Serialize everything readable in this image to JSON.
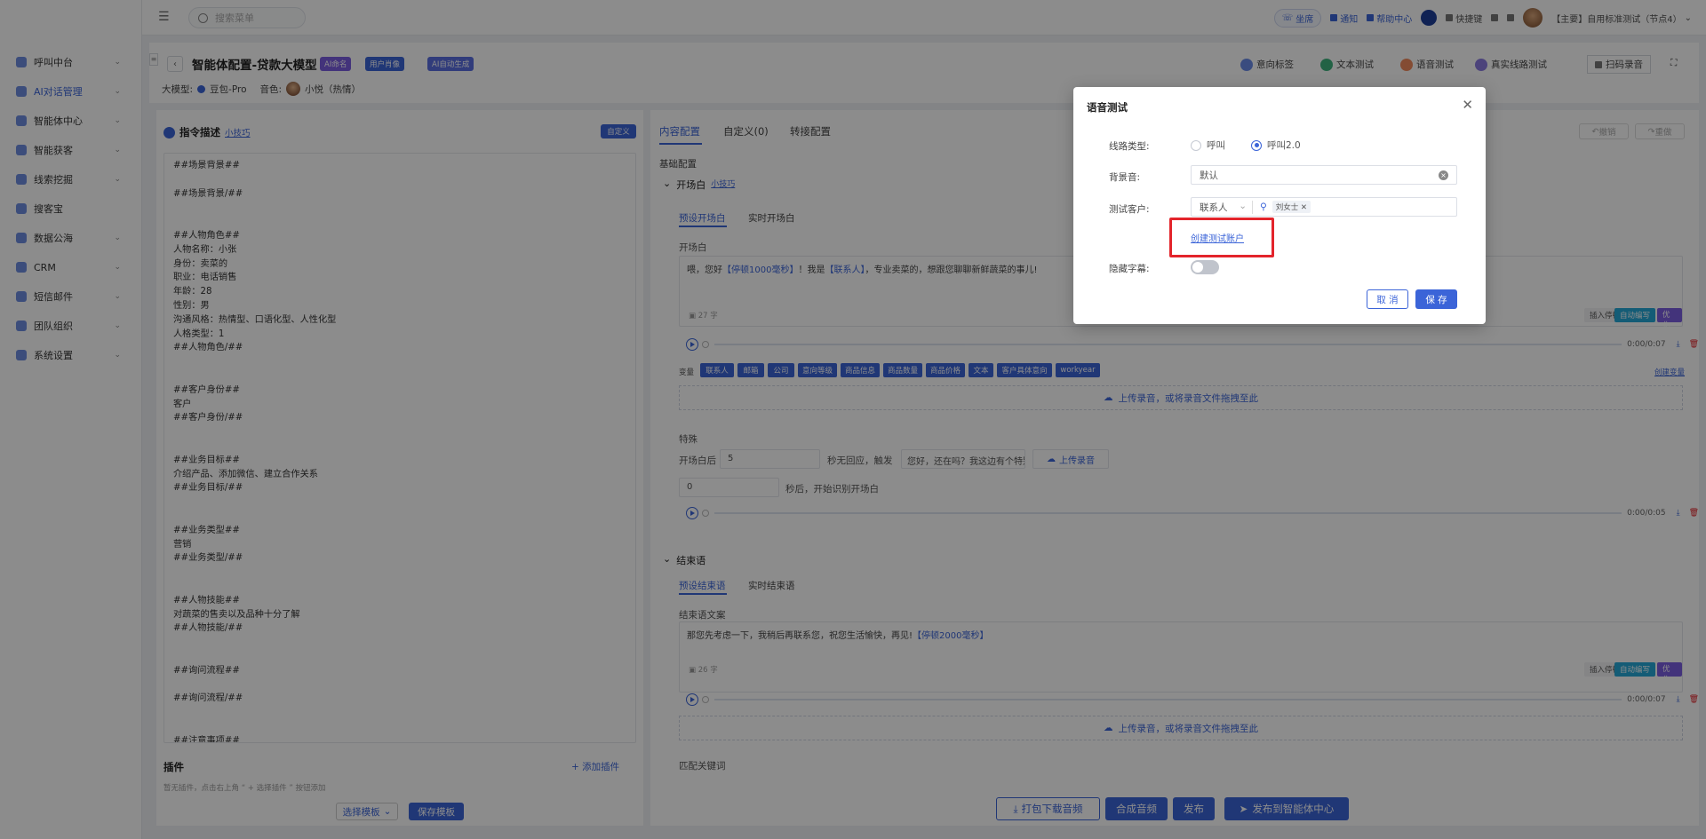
{
  "topbar": {
    "search_placeholder": "搜索菜单",
    "seat": "坐席",
    "notice": "通知",
    "help": "帮助中心",
    "shortcut": "快捷键",
    "user": "【主要】自用标准测试（节点4）"
  },
  "sidebar": {
    "items": [
      {
        "label": "呼叫中台"
      },
      {
        "label": "AI对话管理"
      },
      {
        "label": "智能体中心"
      },
      {
        "label": "智能获客"
      },
      {
        "label": "线索挖掘"
      },
      {
        "label": "搜客宝"
      },
      {
        "label": "数据公海"
      },
      {
        "label": "CRM"
      },
      {
        "label": "短信邮件"
      },
      {
        "label": "团队组织"
      },
      {
        "label": "系统设置"
      }
    ]
  },
  "header": {
    "title": "智能体配置-贷款大模型",
    "tags": [
      "AI命名",
      "用户肖像",
      "AI自动生成"
    ],
    "model_label": "大模型:",
    "model_value": "豆包-Pro",
    "voice_label": "音色:",
    "voice_value": "小悦（热情）",
    "buttons": [
      "意向标签",
      "文本测试",
      "语音测试",
      "真实线路测试",
      "扫码录音"
    ]
  },
  "left": {
    "title": "指令描述",
    "tip": "小技巧",
    "custom_btn": "自定义",
    "lines": [
      "##场景背景##",
      "",
      "##场景背景/##",
      "",
      "",
      "##人物角色##",
      "人物名称：小张",
      "身份：卖菜的",
      "职业：电话销售",
      "年龄：28",
      "性别：男",
      "沟通风格：热情型、口语化型、人性化型",
      "人格类型：1",
      "##人物角色/##",
      "",
      "",
      "##客户身份##",
      "客户",
      "##客户身份/##",
      "",
      "",
      "##业务目标##",
      "介绍产品、添加微信、建立合作关系",
      "##业务目标/##",
      "",
      "",
      "##业务类型##",
      "营销",
      "##业务类型/##",
      "",
      "",
      "##人物技能##",
      "对蔬菜的售卖以及品种十分了解",
      "##人物技能/##",
      "",
      "",
      "##询问流程##",
      "",
      "##询问流程/##",
      "",
      "",
      "##注意事项##"
    ],
    "plugin_title": "插件",
    "add_plugin": "+ 添加插件",
    "plugin_hint": "暂无插件，点击右上角 “ + 选择插件 ” 按钮添加",
    "select_template": "选择模板",
    "save_template": "保存模板"
  },
  "right": {
    "tabs": [
      "内容配置",
      "自定义(0)",
      "转接配置"
    ],
    "undo": "撤销",
    "redo": "重做",
    "basic": "基础配置",
    "opening_section": "开场白",
    "opening_tip": "小技巧",
    "opening_subtabs": [
      "预设开场白",
      "实时开场白"
    ],
    "opening_label": "开场白",
    "opening_text_pre": "喂，您好",
    "opening_pause": "【停顿1000毫秒】",
    "opening_text_mid": "！我是",
    "opening_contact": "【联系人】",
    "opening_text_post": "，专业卖菜的，想跟您聊聊新鲜蔬菜的事儿!",
    "opening_count": "27 字",
    "insert_pause": "插入停顿",
    "auto_write": "自动编写",
    "ai_opt": "AI优化",
    "time1": "0:00/0:07",
    "var_label": "变量",
    "vars": [
      "联系人",
      "邮箱",
      "公司",
      "意向等级",
      "商品信息",
      "商品数量",
      "商品价格",
      "文本",
      "客户具体意向",
      "workyear"
    ],
    "create_var": "创建变量",
    "upload": "上传录音，或将录音文件拖拽至此",
    "special": "特殊",
    "after_open": "开场白后",
    "sec_val": "5",
    "no_response": "秒无回应，触发",
    "trigger_text": "您好，还在吗？我这边有个特别好的",
    "upload_audio": "上传录音",
    "zero_val": "0",
    "identify": "秒后，开始识别开场白",
    "time2": "0:00/0:05",
    "closing_section": "结束语",
    "closing_subtabs": [
      "预设结束语",
      "实时结束语"
    ],
    "closing_label": "结束语文案",
    "closing_text": "那您先考虑一下，我稍后再联系您，祝您生活愉快，再见!",
    "closing_pause": "【停顿2000毫秒】",
    "closing_count": "26 字",
    "time3": "0:00/0:07",
    "keyword": "匹配关键词"
  },
  "footer": {
    "download": "打包下载音频",
    "synth": "合成音频",
    "publish": "发布",
    "publish_center": "发布到智能体中心"
  },
  "modal": {
    "title": "语音测试",
    "line_type": "线路类型:",
    "opt1": "呼叫",
    "opt2": "呼叫2.0",
    "bg_label": "背景音:",
    "bg_value": "默认",
    "customer_label": "测试客户:",
    "customer_select": "联系人",
    "customer_chip": "刘女士",
    "create_link": "创建测试账户",
    "subtitle_label": "隐藏字幕:",
    "cancel": "取 消",
    "save": "保 存"
  },
  "colors": {
    "primary": "#3b64d8",
    "highlight": "#e3242b",
    "purple": "#7b5de0"
  }
}
